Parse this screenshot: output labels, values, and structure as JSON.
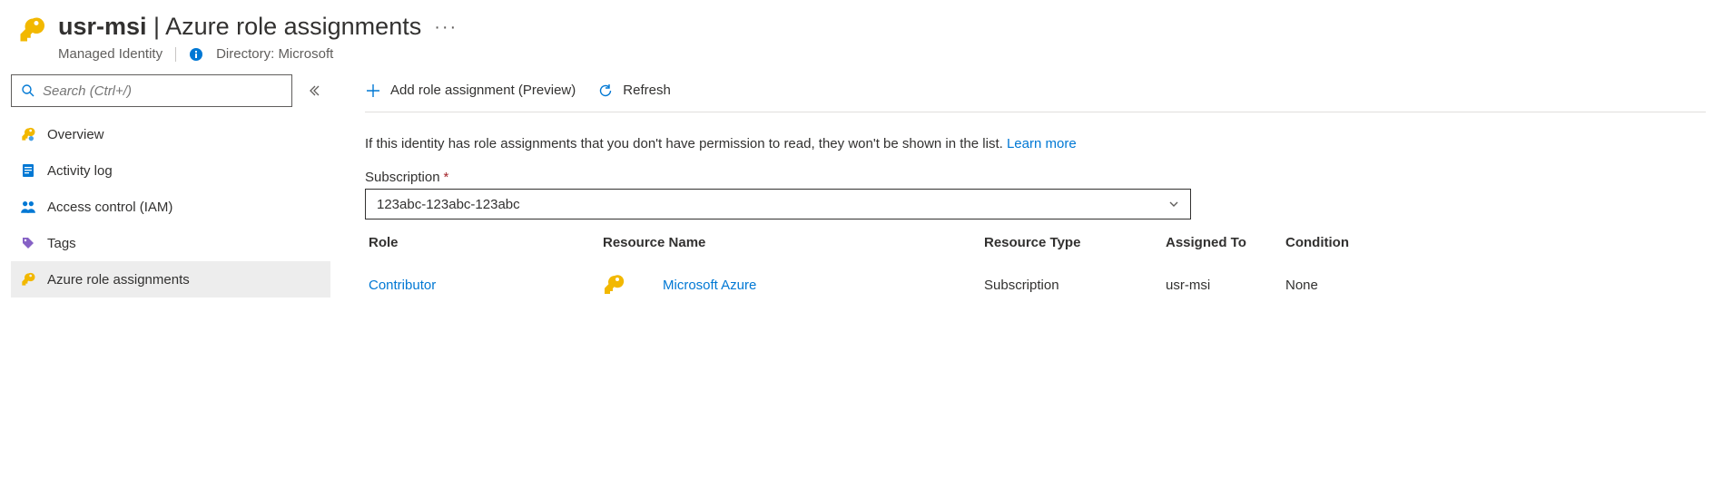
{
  "header": {
    "resource_name": "usr-msi",
    "page_title": "Azure role assignments",
    "resource_type": "Managed Identity",
    "directory_label": "Directory:",
    "directory_name": "Microsoft"
  },
  "sidebar": {
    "search_placeholder": "Search (Ctrl+/)",
    "items": [
      {
        "label": "Overview",
        "icon": "key-small-icon",
        "selected": false
      },
      {
        "label": "Activity log",
        "icon": "log-icon",
        "selected": false
      },
      {
        "label": "Access control (IAM)",
        "icon": "people-icon",
        "selected": false
      },
      {
        "label": "Tags",
        "icon": "tag-icon",
        "selected": false
      },
      {
        "label": "Azure role assignments",
        "icon": "key-yellow-icon",
        "selected": true
      }
    ]
  },
  "toolbar": {
    "add_label": "Add role assignment (Preview)",
    "refresh_label": "Refresh"
  },
  "notice": {
    "text": "If this identity has role assignments that you don't have permission to read, they won't be shown in the list. ",
    "learn_more": "Learn more"
  },
  "subscription": {
    "label": "Subscription",
    "value": "123abc-123abc-123abc"
  },
  "table": {
    "headers": {
      "role": "Role",
      "name": "Resource Name",
      "type": "Resource Type",
      "assigned": "Assigned To",
      "condition": "Condition"
    },
    "rows": [
      {
        "role": "Contributor",
        "name": "Microsoft Azure",
        "type": "Subscription",
        "assigned": "usr-msi",
        "condition": "None"
      }
    ]
  }
}
